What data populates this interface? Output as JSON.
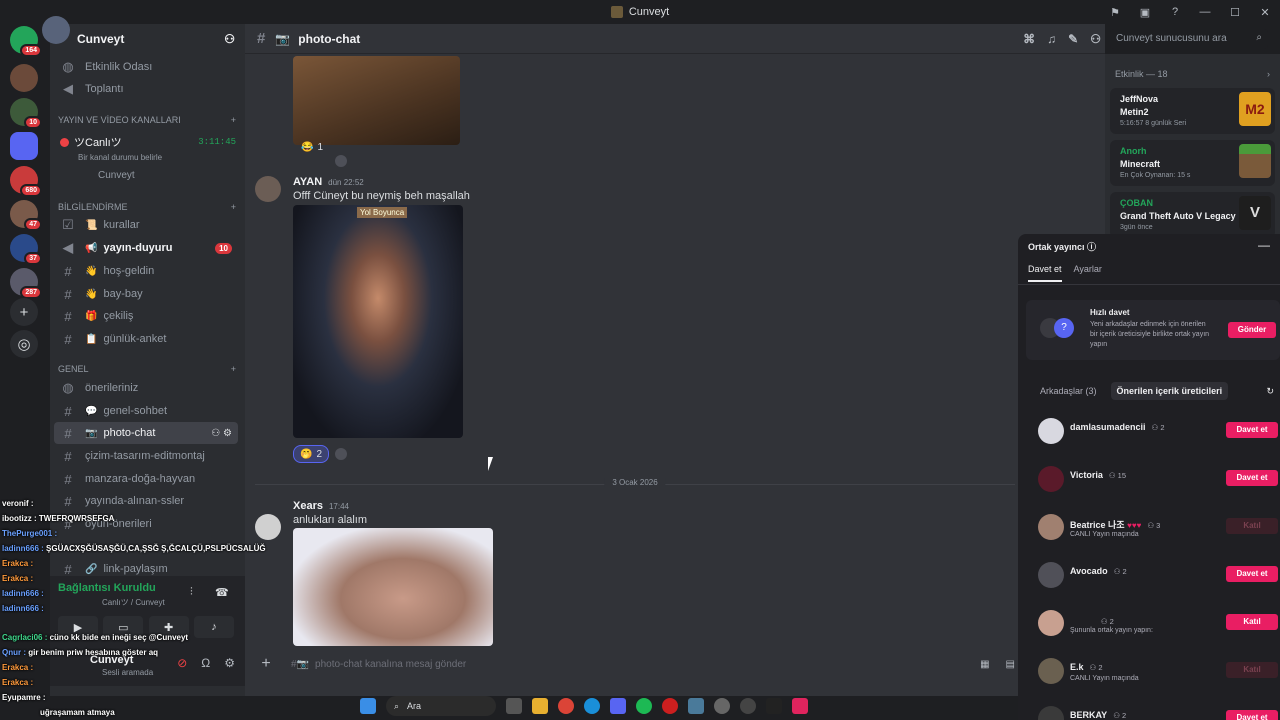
{
  "window": {
    "title": "Cunveyt"
  },
  "servers": {
    "badges": [
      "164",
      "10",
      "680",
      "47",
      "37",
      "287"
    ]
  },
  "sidebar": {
    "guild_name": "Cunveyt",
    "top_channels": [
      {
        "label": "Etkinlik Odası"
      },
      {
        "label": "Toplantı"
      }
    ],
    "cat_stream": "YAYIN VE VİDEO KANALLARI",
    "live_channel": {
      "name": "ツCanlıツ",
      "timer": "3:11:45",
      "status": "Bir kanal durumu belirle",
      "member": "Cunveyt"
    },
    "cat_info": "BİLGİLENDİRME",
    "info_channels": [
      {
        "label": "kurallar"
      },
      {
        "label": "yayın-duyuru",
        "count": "10"
      },
      {
        "label": "hoş-geldin"
      },
      {
        "label": "bay-bay"
      },
      {
        "label": "çekiliş"
      },
      {
        "label": "günlük-anket"
      }
    ],
    "cat_general": "GENEL",
    "general_channels": [
      {
        "label": "önerileriniz"
      },
      {
        "label": "genel-sohbet"
      },
      {
        "label": "photo-chat"
      },
      {
        "label": "çizim-tasarım-editmontaj"
      },
      {
        "label": "manzara-doğa-hayvan"
      },
      {
        "label": "yayında-alınan-ssler"
      },
      {
        "label": "oyun-önerileri"
      },
      {
        "label": "link-paylaşım"
      }
    ]
  },
  "userpanel": {
    "voice_status": "Bağlantısı Kuruldu",
    "voice_sub": "Canlıツ / Cunveyt",
    "username": "Cunveyt",
    "user_status": "Sesli aramada"
  },
  "channel": {
    "name": "photo-chat",
    "composer_placeholder": "photo-chat kanalına mesaj gönder"
  },
  "search": {
    "placeholder": "Cunveyt sunucusunu ara"
  },
  "messages": [
    {
      "reaction_count": "1"
    },
    {
      "author": "AYAN",
      "time": "dün 22:52",
      "text": "Offf Cüneyt bu neymiş beh maşallah",
      "sign": "Yol Boyunca",
      "reaction_count": "2"
    },
    {
      "author": "Xears",
      "time": "17:44",
      "text": "anlukları alalım"
    }
  ],
  "date_separator": "3 Ocak 2026",
  "activity": {
    "header": "Etkinlik — 18",
    "cards": [
      {
        "who": "JeffNova",
        "game": "Metin2",
        "meta": "5:16:57  8 günlük Seri",
        "color": "#f2f3f5"
      },
      {
        "who": "Anorh",
        "game": "Minecraft",
        "meta": "En Çok Oynanan: 15 s",
        "color": "#23a55a"
      },
      {
        "who": "ÇOBAN",
        "game": "Grand Theft Auto V Legacy",
        "meta": "3gün önce",
        "color": "#23a55a"
      }
    ]
  },
  "copanel": {
    "title": "Ortak yayıncı",
    "tab_invite": "Davet et",
    "tab_settings": "Ayarlar",
    "quick_title": "Hızlı davet",
    "quick_desc": "Yeni arkadaşlar edinmek için önerilen bir içerik üreticisiyle birlikte ortak yayın yapın",
    "quick_button": "Gönder",
    "sub_friends": "Arkadaşlar (3)",
    "sub_suggested": "Önerilen içerik üreticileri",
    "people": [
      {
        "name": "damlasumadencii",
        "count": "2",
        "status": "",
        "action": "Davet et",
        "enabled": true
      },
      {
        "name": "Victoria",
        "count": "15",
        "status": "",
        "action": "Davet et",
        "enabled": true
      },
      {
        "name": "Beatrice 나조",
        "count": "3",
        "status": "CANLI Yayın maçında",
        "action": "Katıl",
        "enabled": false
      },
      {
        "name": "Avocado",
        "count": "2",
        "status": "",
        "action": "Davet et",
        "enabled": true
      },
      {
        "name": "ᅟᅟᅟ",
        "count": "2",
        "status": "Şununla ortak yayın yapın:",
        "action": "Katıl",
        "enabled": true
      },
      {
        "name": "E.k",
        "count": "2",
        "status": "CANLI Yayın maçında",
        "action": "Katıl",
        "enabled": false
      },
      {
        "name": "BERKAY",
        "count": "2",
        "status": "",
        "action": "Davet et",
        "enabled": true
      }
    ]
  },
  "overlay_chat": [
    {
      "user": "veronif :",
      "text": "",
      "color": "#ffffff"
    },
    {
      "user": "ibootizz :",
      "text": "TWEFRQWRSEFGA",
      "color": "#ffffff"
    },
    {
      "user": "ThePurge001 :",
      "text": "",
      "color": "#6aa0ff"
    },
    {
      "user": "ladinn666 :",
      "text": "ŞGÜACXŞĞÜSAŞĞÜ,CA,ŞSĞ Ş,ĞCALÇÜ,PSLPÜCSALÜĞ",
      "color": "#6aa0ff"
    },
    {
      "user": "Erakca :",
      "text": "",
      "color": "#ff9a3c"
    },
    {
      "user": "Erakca :",
      "text": "",
      "color": "#ff9a3c"
    },
    {
      "user": "ladinn666 :",
      "text": "",
      "color": "#6aa0ff"
    },
    {
      "user": "ladinn666 :",
      "text": "",
      "color": "#6aa0ff"
    },
    {
      "user": "Cagrlaci06 :",
      "text": "cüno kk bide en ineği seç @Cunveyt",
      "color": "#3fd88c"
    },
    {
      "user": "Qnur :",
      "text": "gir benim priw hesabına göster aq",
      "color": "#6aa0ff"
    },
    {
      "user": "Erakca :",
      "text": "",
      "color": "#ff9a3c"
    },
    {
      "user": "Erakca :",
      "text": "",
      "color": "#ff9a3c"
    },
    {
      "user": "Eyupamre :",
      "text": "",
      "color": "#ffffff"
    },
    {
      "user": "",
      "text": "uğraşamam atmaya",
      "color": "#ffffff"
    }
  ],
  "taskbar": {
    "search": "Ara"
  }
}
